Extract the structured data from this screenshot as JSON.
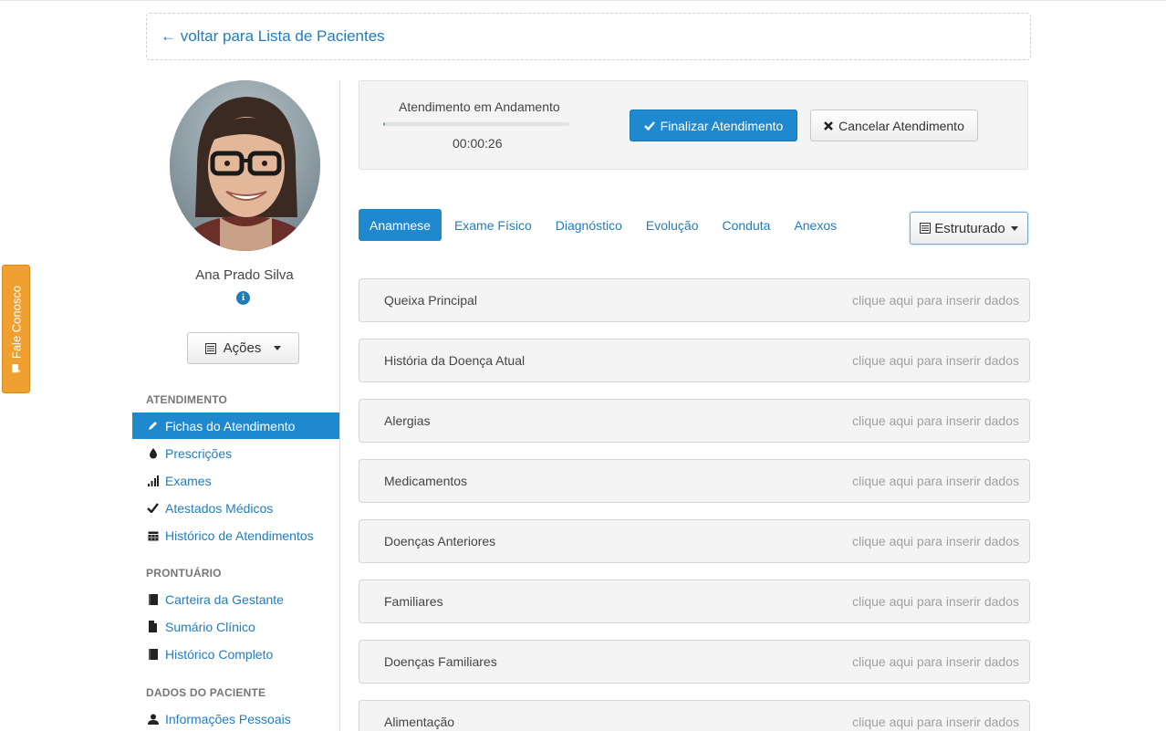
{
  "back_link": "← voltar para Lista de Pacientes",
  "feedback_tab": "Fale Conosco",
  "patient": {
    "name": "Ana Prado Silva",
    "actions_label": "Ações"
  },
  "sidebar": {
    "sections": [
      {
        "title": "ATENDIMENTO",
        "items": [
          {
            "label": "Fichas do Atendimento",
            "icon": "pencil-icon",
            "active": true
          },
          {
            "label": "Prescrições",
            "icon": "drop-icon",
            "active": false
          },
          {
            "label": "Exames",
            "icon": "signal-icon",
            "active": false
          },
          {
            "label": "Atestados Médicos",
            "icon": "check-icon",
            "active": false
          },
          {
            "label": "Histórico de Atendimentos",
            "icon": "calendar-icon",
            "active": false
          }
        ]
      },
      {
        "title": "PRONTUÁRIO",
        "items": [
          {
            "label": "Carteira da Gestante",
            "icon": "book-icon",
            "active": false
          },
          {
            "label": "Sumário Clínico",
            "icon": "file-icon",
            "active": false
          },
          {
            "label": "Histórico Completo",
            "icon": "book-icon",
            "active": false
          }
        ]
      },
      {
        "title": "DADOS DO PACIENTE",
        "items": [
          {
            "label": "Informações Pessoais",
            "icon": "user-icon",
            "active": false
          }
        ]
      }
    ]
  },
  "status": {
    "label": "Atendimento em Andamento",
    "timer": "00:00:26",
    "progress": 0.01,
    "finish_button": "Finalizar Atendimento",
    "cancel_button": "Cancelar Atendimento"
  },
  "tabs": [
    {
      "label": "Anamnese",
      "active": true
    },
    {
      "label": "Exame Físico",
      "active": false
    },
    {
      "label": "Diagnóstico",
      "active": false
    },
    {
      "label": "Evolução",
      "active": false
    },
    {
      "label": "Conduta",
      "active": false
    },
    {
      "label": "Anexos",
      "active": false
    }
  ],
  "view_mode": "Estruturado",
  "fields": [
    {
      "label": "Queixa Principal",
      "hint": "clique aqui para inserir dados"
    },
    {
      "label": "História da Doença Atual",
      "hint": "clique aqui para inserir dados"
    },
    {
      "label": "Alergias",
      "hint": "clique aqui para inserir dados"
    },
    {
      "label": "Medicamentos",
      "hint": "clique aqui para inserir dados"
    },
    {
      "label": "Doenças Anteriores",
      "hint": "clique aqui para inserir dados"
    },
    {
      "label": "Familiares",
      "hint": "clique aqui para inserir dados"
    },
    {
      "label": "Doenças Familiares",
      "hint": "clique aqui para inserir dados"
    },
    {
      "label": "Alimentação",
      "hint": "clique aqui para inserir dados"
    }
  ],
  "colors": {
    "primary": "#1f89cf",
    "link": "#1f7dbf",
    "feedback_tab": "#f0a030",
    "progress": "#5cb85c"
  }
}
